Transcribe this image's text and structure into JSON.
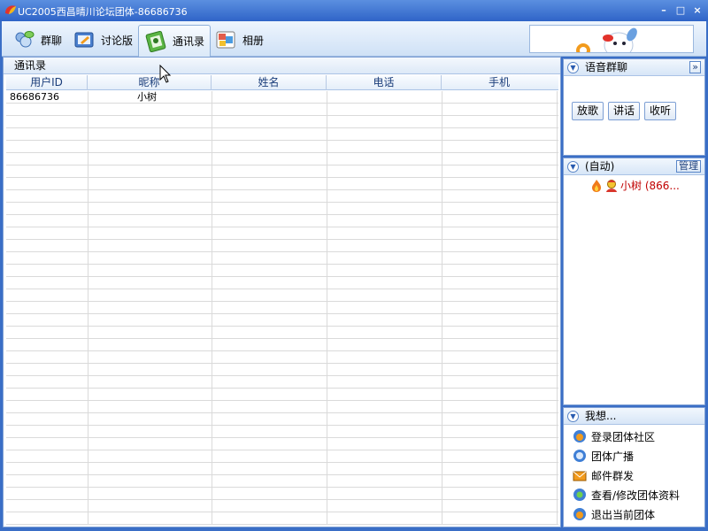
{
  "window": {
    "title": "UC2005西昌晴川论坛团体-86686736",
    "controls": [
      "–",
      "□",
      "×"
    ]
  },
  "toolbar": {
    "tabs": [
      {
        "label": "群聊",
        "icon": "group-chat-icon"
      },
      {
        "label": "讨论版",
        "icon": "forum-icon"
      },
      {
        "label": "通讯录",
        "icon": "address-book-icon"
      },
      {
        "label": "相册",
        "icon": "album-icon"
      }
    ],
    "active_tab": "通讯录"
  },
  "main": {
    "title": "通讯录",
    "columns": [
      "用户ID",
      "昵称",
      "姓名",
      "电话",
      "手机"
    ],
    "rows": [
      {
        "user_id": "86686736",
        "nickname": "小树",
        "name": "",
        "phone": "",
        "mobile": ""
      }
    ]
  },
  "voice_panel": {
    "title": "语音群聊",
    "expand_label": "»",
    "buttons": [
      "放歌",
      "讲话",
      "收听"
    ]
  },
  "members_panel": {
    "title": "(自动)",
    "manage_label": "管理",
    "members": [
      {
        "label": "小树 (866..."
      }
    ]
  },
  "actions_panel": {
    "title": "我想...",
    "items": [
      {
        "label": "登录团体社区",
        "icon": "community-icon"
      },
      {
        "label": "团体广播",
        "icon": "broadcast-icon"
      },
      {
        "label": "邮件群发",
        "icon": "mail-icon"
      },
      {
        "label": "查看/修改团体资料",
        "icon": "profile-icon"
      },
      {
        "label": "退出当前团体",
        "icon": "exit-icon"
      }
    ]
  },
  "colors": {
    "titlebar": "#2f64c8",
    "border": "#7d9fd4",
    "member_text": "#c00000"
  }
}
